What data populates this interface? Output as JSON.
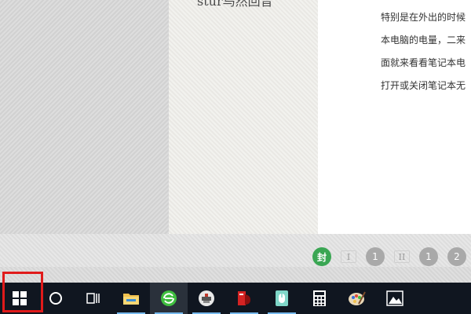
{
  "document": {
    "sidebar_title": "stur鸟然回音",
    "lines": [
      "特别是在外出的时候",
      "本电脑的电量，二来",
      "面就来看看笔记本电",
      "打开或关闭笔记本无"
    ]
  },
  "page_nav": {
    "items": [
      {
        "label": "封",
        "state": "active"
      },
      {
        "label": "I",
        "state": "roman"
      },
      {
        "label": "1",
        "state": "normal"
      },
      {
        "label": "II",
        "state": "roman"
      },
      {
        "label": "1",
        "state": "normal"
      },
      {
        "label": "2",
        "state": "normal"
      }
    ]
  },
  "taskbar": {
    "items": [
      {
        "name": "start-button",
        "icon": "windows-logo-icon"
      },
      {
        "name": "cortana-search-button",
        "icon": "cortana-circle-icon"
      },
      {
        "name": "task-view-button",
        "icon": "task-view-icon"
      },
      {
        "name": "file-explorer-button",
        "icon": "folder-icon",
        "running": true
      },
      {
        "name": "browser-button",
        "icon": "green-browser-icon",
        "running": true,
        "active": true
      },
      {
        "name": "photo-tool-button",
        "icon": "tool-icon",
        "running": true
      },
      {
        "name": "pdf-reader-button",
        "icon": "pdf-reader-icon",
        "running": true
      },
      {
        "name": "mouse-app-button",
        "icon": "mouse-icon",
        "running": true
      },
      {
        "name": "calculator-button",
        "icon": "calculator-icon"
      },
      {
        "name": "paint-button",
        "icon": "paint-palette-icon"
      },
      {
        "name": "photos-button",
        "icon": "photos-mountain-icon"
      }
    ]
  },
  "colors": {
    "highlight": "#e01a1a",
    "page_active": "#3aa653",
    "taskbar": "#101620"
  }
}
